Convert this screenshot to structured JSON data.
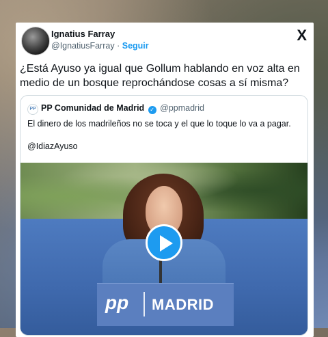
{
  "tweet": {
    "author_name": "Ignatius Farray",
    "author_handle": "@IgnatiusFarray",
    "separator": "·",
    "follow_label": "Seguir",
    "brand_icon": "X",
    "text": "¿Está Ayuso ya igual que Gollum hablando en voz alta en medio de un bosque reprochándose cosas a sí misma?"
  },
  "quote": {
    "avatar_text": "PP",
    "author_name": "PP Comunidad de Madrid",
    "verified_icon": "✓",
    "author_handle": "@ppmadrid",
    "line1": "El dinero de los madrileños no se toca y el que lo toque lo va a pagar.",
    "line2": "@IdiazAyuso",
    "media": {
      "podium_logo": "pp",
      "podium_text": "MADRID"
    }
  },
  "colors": {
    "accent": "#1d9bf0",
    "text": "#0f1419",
    "muted": "#536471",
    "border": "#cfd9de"
  }
}
